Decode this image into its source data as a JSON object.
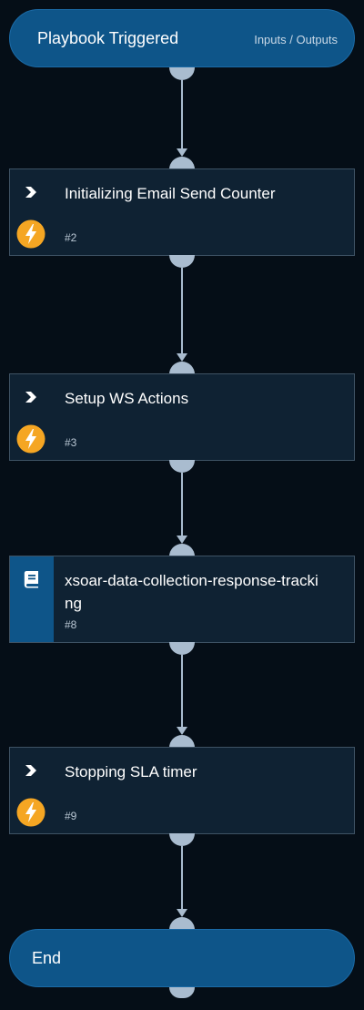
{
  "start": {
    "title": "Playbook Triggered",
    "io_link": "Inputs / Outputs"
  },
  "tasks": [
    {
      "title": "Initializing Email Send Counter",
      "id": "#2",
      "type": "automation"
    },
    {
      "title": "Setup WS Actions",
      "id": "#3",
      "type": "automation"
    },
    {
      "title": "xsoar-data-collection-response-tracking",
      "id": "#8",
      "type": "sub-playbook"
    },
    {
      "title": "Stopping SLA timer",
      "id": "#9",
      "type": "automation"
    }
  ],
  "end": {
    "title": "End"
  },
  "colors": {
    "background": "#050e17",
    "pill": "#0e5589",
    "task": "#0f2233",
    "connector": "#a9bccf",
    "bolt": "#f5a623"
  },
  "icons": {
    "chevron": "chevron-right-icon",
    "bolt": "lightning-icon",
    "book": "book-icon"
  }
}
